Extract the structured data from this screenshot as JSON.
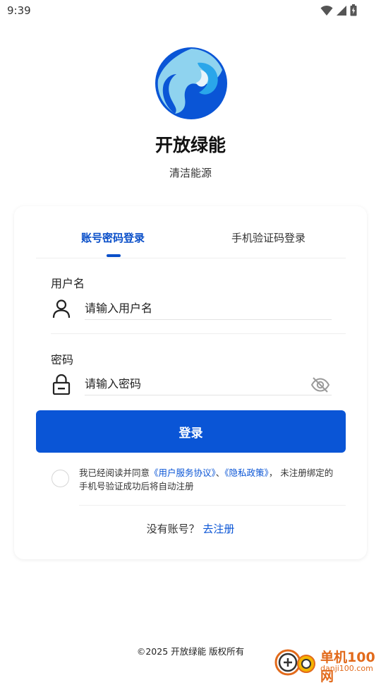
{
  "status": {
    "time": "9:39"
  },
  "app": {
    "name": "开放绿能",
    "slogan": "清洁能源"
  },
  "tabs": {
    "account": "账号密码登录",
    "sms": "手机验证码登录"
  },
  "form": {
    "username_label": "用户名",
    "username_placeholder": "请输入用户名",
    "password_label": "密码",
    "password_placeholder": "请输入密码",
    "login_button": "登录"
  },
  "agreement": {
    "prefix": "我已经阅读并同意",
    "service_link": "《用户服务协议》",
    "separator": "、",
    "privacy_link": "《隐私政策》",
    "suffix": "， 未注册绑定的手机号验证成功后将自动注册"
  },
  "register": {
    "prompt": "没有账号？",
    "link": "去注册"
  },
  "footer": {
    "copyright": "©2025 开放绿能 版权所有"
  },
  "watermark": {
    "title": "单机100网",
    "url": "danji100.com"
  },
  "colors": {
    "accent": "#0a55d6",
    "tab_active": "#0a4fc9"
  }
}
